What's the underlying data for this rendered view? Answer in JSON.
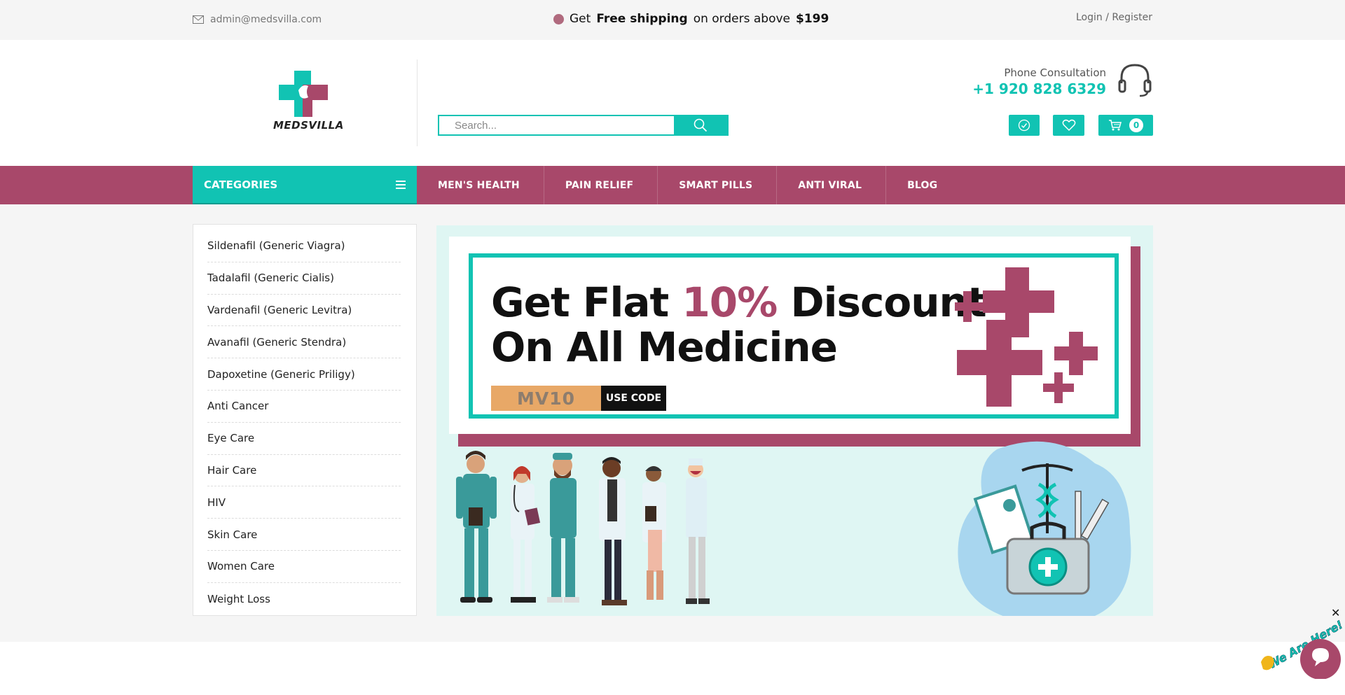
{
  "topbar": {
    "email": "admin@medsvilla.com",
    "promo_prefix": "Get",
    "promo_bold": "Free shipping",
    "promo_middle": "on orders above",
    "promo_amount": "$199",
    "login": "Login / Register"
  },
  "header": {
    "logo_text": "MEDSVILLA",
    "search_placeholder": "Search...",
    "consult_label": "Phone Consultation",
    "consult_phone": "+1 920 828 6329",
    "cart_count": "0"
  },
  "nav": {
    "categories_label": "CATEGORIES",
    "items": [
      "MEN'S HEALTH",
      "PAIN RELIEF",
      "SMART PILLS",
      "ANTI VIRAL",
      "BLOG"
    ]
  },
  "categories": [
    "Sildenafil (Generic Viagra)",
    "Tadalafil (Generic Cialis)",
    "Vardenafil (Generic Levitra)",
    "Avanafil (Generic Stendra)",
    "Dapoxetine (Generic Priligy)",
    "Anti Cancer",
    "Eye Care",
    "Hair Care",
    "HIV",
    "Skin Care",
    "Women Care",
    "Weight Loss"
  ],
  "banner": {
    "line1_a": "Get Flat",
    "line1_pct": "10%",
    "line1_b": "Discount",
    "line2": "On All Medicine",
    "code": "MV10",
    "use_code": "USE CODE"
  },
  "chat": {
    "badge_text": "We Are Here!",
    "close": "✕"
  },
  "colors": {
    "teal": "#11c3b3",
    "maroon": "#a8486a",
    "code_bg": "#e8a867"
  }
}
